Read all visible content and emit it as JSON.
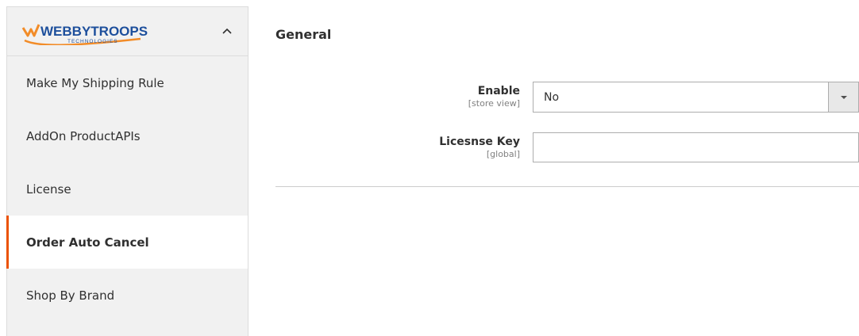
{
  "logo": {
    "brand_text": "WEBBYTROOPS",
    "sub_text": "TECHNOLOGIES"
  },
  "sidebar": {
    "items": [
      {
        "label": "Make My Shipping Rule"
      },
      {
        "label": "AddOn ProductAPIs"
      },
      {
        "label": "License"
      },
      {
        "label": "Order Auto Cancel"
      },
      {
        "label": "Shop By Brand"
      }
    ]
  },
  "main": {
    "section_title": "General",
    "fields": {
      "enable": {
        "label": "Enable",
        "scope": "[store view]",
        "value": "No"
      },
      "license_key": {
        "label": "Licesnse Key",
        "scope": "[global]",
        "value": ""
      }
    }
  },
  "colors": {
    "accent": "#eb5202",
    "sidebar_bg": "#f1f1f1",
    "logo_blue": "#1d4f9c",
    "logo_orange": "#f28c28"
  }
}
